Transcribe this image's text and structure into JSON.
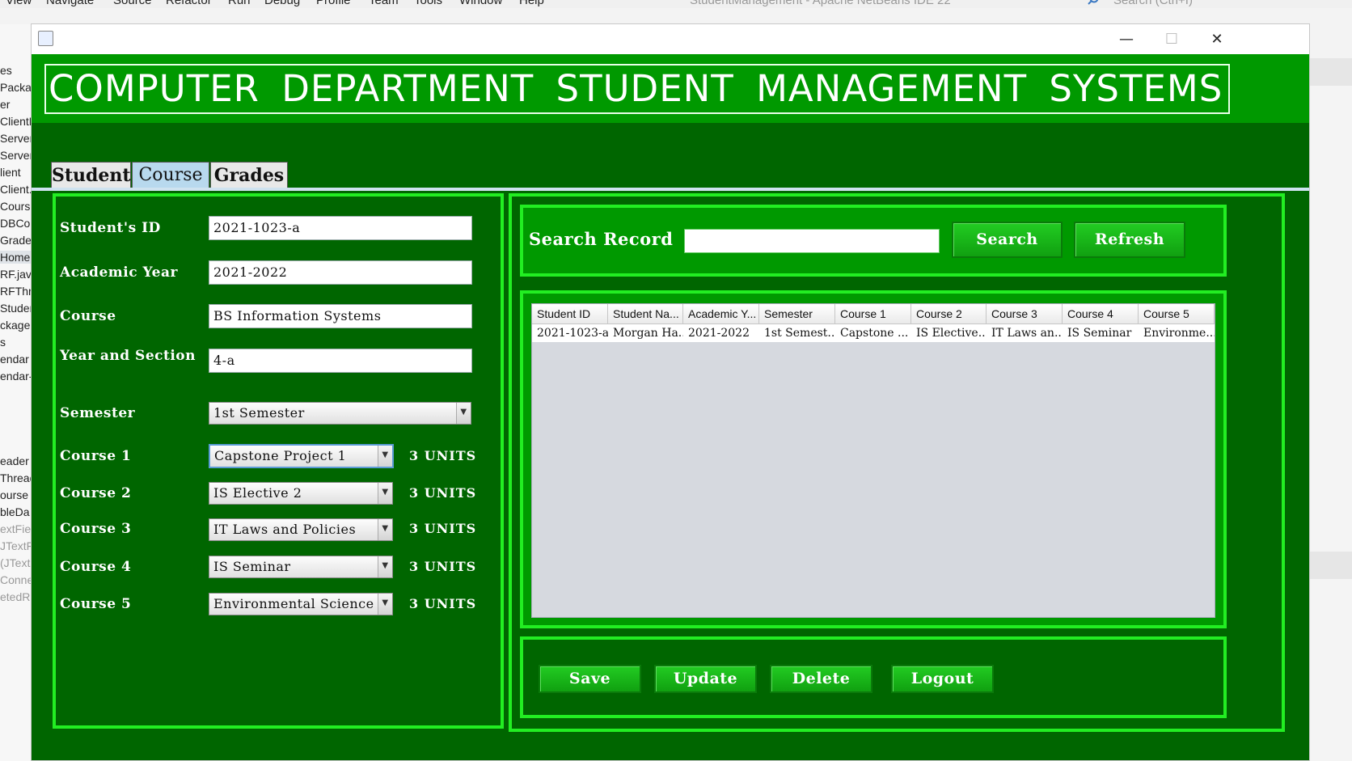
{
  "ide": {
    "menu": [
      "View",
      "Navigate",
      "Source",
      "Refactor",
      "Run",
      "Debug",
      "Profile",
      "Team",
      "Tools",
      "Window",
      "Help"
    ],
    "title": "StudentManagement - Apache NetBeans IDE 22",
    "search_placeholder": "Search (Ctrl+I)",
    "tree": [
      "es",
      "Packa",
      "er",
      "ClientH",
      "Server",
      "Server",
      "lient",
      "Client.",
      "Course",
      "DBCor",
      "Grade",
      "Home",
      "RF.java",
      "RFThre",
      "Studen",
      "ckage",
      "s",
      "endar",
      "endar-",
      "eader",
      "Thread",
      "ourse",
      "bleDa",
      "extFie",
      "JTextF",
      "(JText",
      "Conne",
      "etedRe"
    ]
  },
  "window": {
    "controls": {
      "minimize": "—",
      "maximize": "☐",
      "close": "✕"
    }
  },
  "app": {
    "title": "COMPUTER DEPARTMENT STUDENT MANAGEMENT SYSTEMS",
    "tabs": [
      {
        "label": "Student",
        "active": false
      },
      {
        "label": "Course",
        "active": true
      },
      {
        "label": "Grades",
        "active": false
      }
    ]
  },
  "form": {
    "student_id": {
      "label": "Student's ID",
      "value": "2021-1023-a"
    },
    "academic_year": {
      "label": "Academic Year",
      "value": "2021-2022"
    },
    "course": {
      "label": "Course",
      "value": "BS Information Systems"
    },
    "year_section": {
      "label": "Year and Section",
      "value": "4-a"
    },
    "semester": {
      "label": "Semester",
      "value": "1st Semester"
    },
    "courses": [
      {
        "label": "Course 1",
        "value": "Capstone Project 1",
        "units": "3 UNITS"
      },
      {
        "label": "Course 2",
        "value": "IS Elective 2",
        "units": "3 UNITS"
      },
      {
        "label": "Course 3",
        "value": "IT Laws and Policies",
        "units": "3 UNITS"
      },
      {
        "label": "Course 4",
        "value": "IS Seminar",
        "units": "3 UNITS"
      },
      {
        "label": "Course 5",
        "value": "Environmental Science",
        "units": "3 UNITS"
      }
    ]
  },
  "search": {
    "label": "Search Record",
    "value": "",
    "search_button": "Search",
    "refresh_button": "Refresh"
  },
  "table": {
    "columns": [
      "Student ID",
      "Student Na...",
      "Academic Y...",
      "Semester",
      "Course 1",
      "Course 2",
      "Course 3",
      "Course 4",
      "Course 5"
    ],
    "rows": [
      [
        "2021-1023-a",
        "Morgan Ha...",
        "2021-2022",
        "1st Semest...",
        "Capstone ...",
        "IS Elective...",
        "IT Laws an...",
        "IS Seminar",
        "Environme..."
      ]
    ]
  },
  "actions": {
    "save": "Save",
    "update": "Update",
    "delete": "Delete",
    "logout": "Logout"
  },
  "colors": {
    "app_bg": "#006600",
    "header_bg": "#009900",
    "panel_border": "#22ee22",
    "button_bg": "#22cc22"
  }
}
